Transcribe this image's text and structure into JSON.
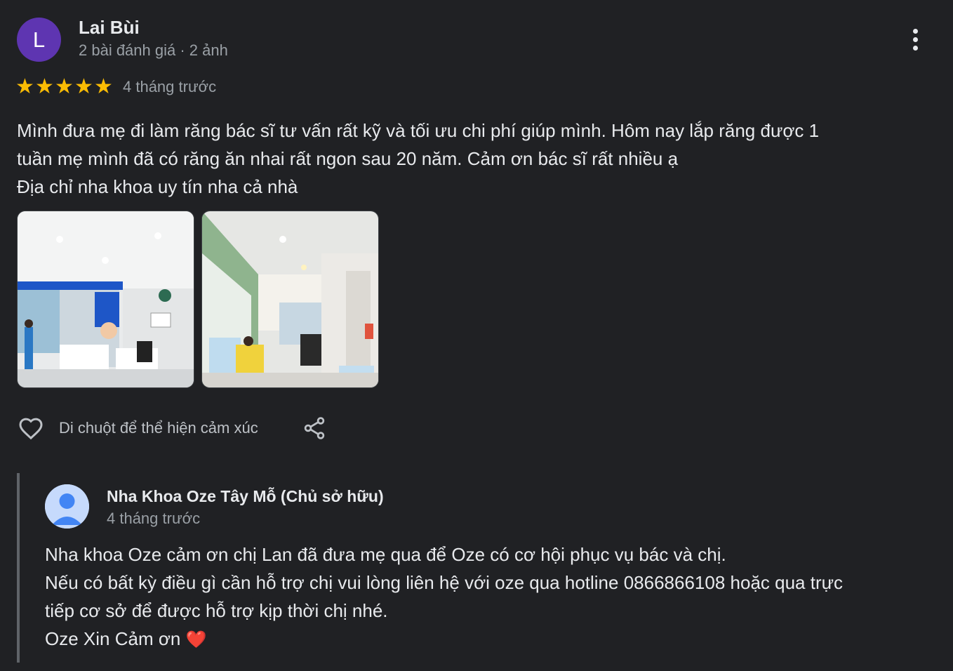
{
  "review": {
    "author_initial": "L",
    "author_name": "Lai Bùi",
    "author_meta": "2 bài đánh giá · 2 ảnh",
    "rating": 5,
    "date": "4 tháng trước",
    "text_lines": [
      "Mình đưa mẹ đi làm răng bác sĩ tư vấn rất kỹ và tối ưu chi phí giúp mình. Hôm nay lắp răng được 1",
      "tuần mẹ mình đã có răng ăn nhai rất ngon sau 20 năm. Cảm ơn bác sĩ rất nhiều ạ",
      "Địa chỉ nha khoa uy tín nha cả nhà"
    ],
    "reaction_label": "Di chuột để thể hiện cảm xúc",
    "star_color": "#fbbc04",
    "avatar_color": "#5e35b1"
  },
  "reply": {
    "owner_name": "Nha Khoa Oze Tây Mỗ (Chủ sở hữu)",
    "date": "4 tháng trước",
    "text_lines": [
      "Nha khoa Oze cảm ơn chị Lan đã đưa mẹ qua để Oze có cơ hội phục vụ bác và chị.",
      "Nếu có bất kỳ điều gì cần hỗ trợ chị vui lòng liên hệ với oze qua hotline 0866866108 hoặc qua trực",
      "tiếp cơ sở để được hỗ trợ kịp thời chị nhé."
    ],
    "closing": "Oze Xin Cảm ơn",
    "closing_emoji": "❤️"
  },
  "icons": {
    "menu": "more-vert-icon",
    "like": "heart-outline-icon",
    "share": "share-icon"
  }
}
